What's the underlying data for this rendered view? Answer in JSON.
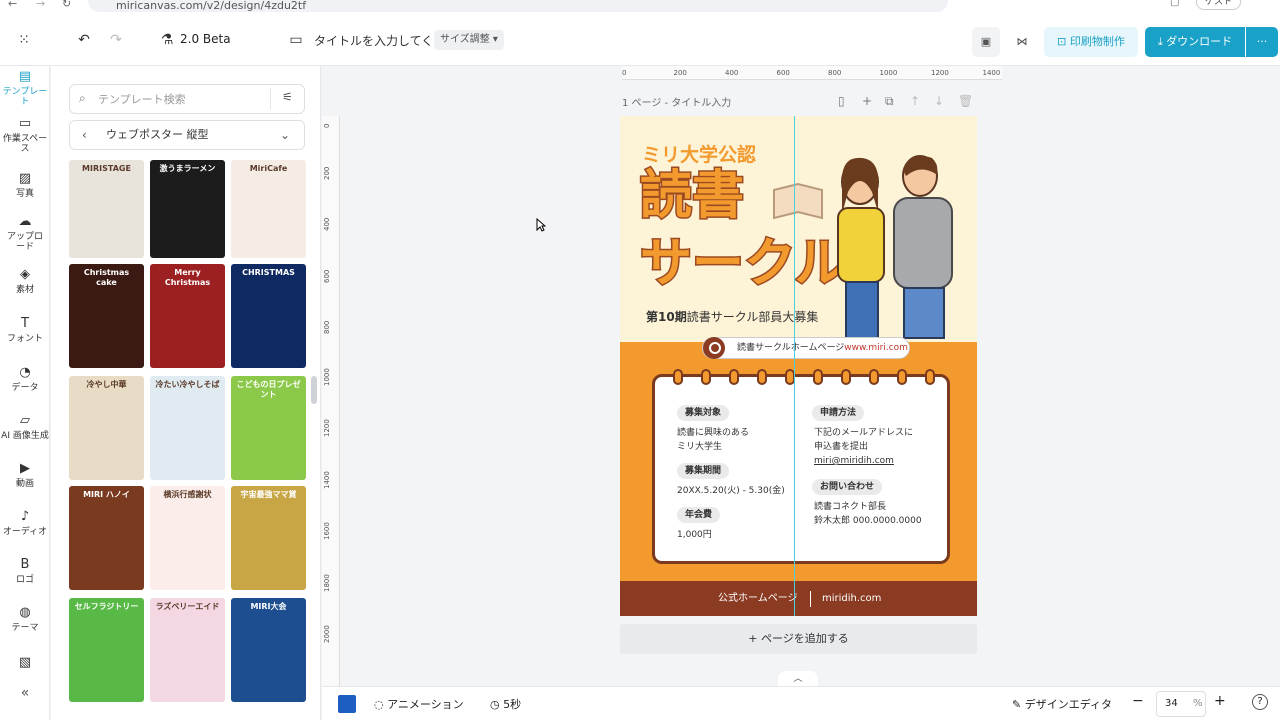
{
  "browser": {
    "url": "miricanvas.com/v2/design/4zdu2tf",
    "profile_label": "ゲスト"
  },
  "header": {
    "version": "2.0 Beta",
    "title_placeholder": "タイトルを入力してくた",
    "size_label": "サイズ調整",
    "print_label": "印刷物制作",
    "download_label": "ダウンロード"
  },
  "rail": {
    "items": [
      {
        "label": "テンプレート",
        "icon": "template-icon"
      },
      {
        "label": "作業スペース",
        "icon": "workspace-icon"
      },
      {
        "label": "写真",
        "icon": "photo-icon"
      },
      {
        "label": "アップロード",
        "icon": "upload-icon"
      },
      {
        "label": "素材",
        "icon": "elements-icon"
      },
      {
        "label": "フォント",
        "icon": "font-icon"
      },
      {
        "label": "データ",
        "icon": "chart-icon"
      },
      {
        "label": "AI 画像生成",
        "icon": "ai-image-icon"
      },
      {
        "label": "動画",
        "icon": "video-icon"
      },
      {
        "label": "オーディオ",
        "icon": "audio-icon"
      },
      {
        "label": "ロゴ",
        "icon": "logo-icon"
      },
      {
        "label": "テーマ",
        "icon": "theme-icon"
      }
    ]
  },
  "panel": {
    "search_placeholder": "テンプレート検索",
    "category": "ウェブポスター 縦型",
    "thumbs": [
      {
        "text": "MIRISTAGE",
        "color": "#e8e4dc"
      },
      {
        "text": "激うまラーメン",
        "color": "#1c1c1c"
      },
      {
        "text": "MiriCafe",
        "color": "#f6ece6"
      },
      {
        "text": "Christmas cake",
        "color": "#3a1a12"
      },
      {
        "text": "Merry Christmas",
        "color": "#9c1f22"
      },
      {
        "text": "CHRISTMAS",
        "color": "#0f2a62"
      },
      {
        "text": "冷やし中華",
        "color": "#e9dcc7"
      },
      {
        "text": "冷たい冷やしそば",
        "color": "#dfeaf1"
      },
      {
        "text": "こどもの日プレゼント",
        "color": "#8cc94a"
      },
      {
        "text": "MIRI ハノイ",
        "color": "#7a3a20"
      },
      {
        "text": "横浜行感謝状",
        "color": "#fbeeea"
      },
      {
        "text": "宇宙最強ママ賞",
        "color": "#c8a646"
      },
      {
        "text": "セルフラジトリー",
        "color": "#58b947"
      },
      {
        "text": "ラズベリーエイド",
        "color": "#f3d7e3"
      },
      {
        "text": "MIRI大会",
        "color": "#1d4e8f"
      }
    ]
  },
  "canvas": {
    "page_label": "1 ページ - タイトル入力",
    "ruler_top": [
      "0",
      "200",
      "400",
      "600",
      "800",
      "1000",
      "1200",
      "1400"
    ],
    "ruler_left": [
      "0",
      "200",
      "400",
      "600",
      "800",
      "1000",
      "1200",
      "1400",
      "1600",
      "1800",
      "2000"
    ],
    "add_page": "ページを追加する"
  },
  "poster": {
    "badge": "ミリ大学公認",
    "title_line1": "読書",
    "title_line2": "サークル",
    "subtitle_bold": "第10期",
    "subtitle_rest": "読書サークル部員大募集",
    "url_label": "読書サークルホームページ",
    "url_link": "www.miri.com",
    "sections": {
      "target_label": "募集対象",
      "target_text1": "読書に興味のある",
      "target_text2": "ミリ大学生",
      "period_label": "募集期間",
      "period_text": "20XX.5.20(火) - 5.30(金)",
      "fee_label": "年会費",
      "fee_text": "1,000円",
      "apply_label": "申請方法",
      "apply_text1": "下記のメールアドレスに",
      "apply_text2": "申込書を提出",
      "apply_email": "miri@miridih.com",
      "contact_label": "お問い合わせ",
      "contact_text1": "読書コネクト部長",
      "contact_text2": "鈴木太郎 000.0000.0000"
    },
    "footer_left": "公式ホームページ",
    "footer_right": "miridih.com"
  },
  "bottom": {
    "animation": "アニメーション",
    "duration": "5秒",
    "design_editor": "デザインエディタ",
    "zoom": "34",
    "zoom_unit": "%",
    "help": "?"
  },
  "colors": {
    "accent": "#1aa1c8",
    "poster_orange": "#f29a2e",
    "poster_brown": "#8a3b22"
  }
}
